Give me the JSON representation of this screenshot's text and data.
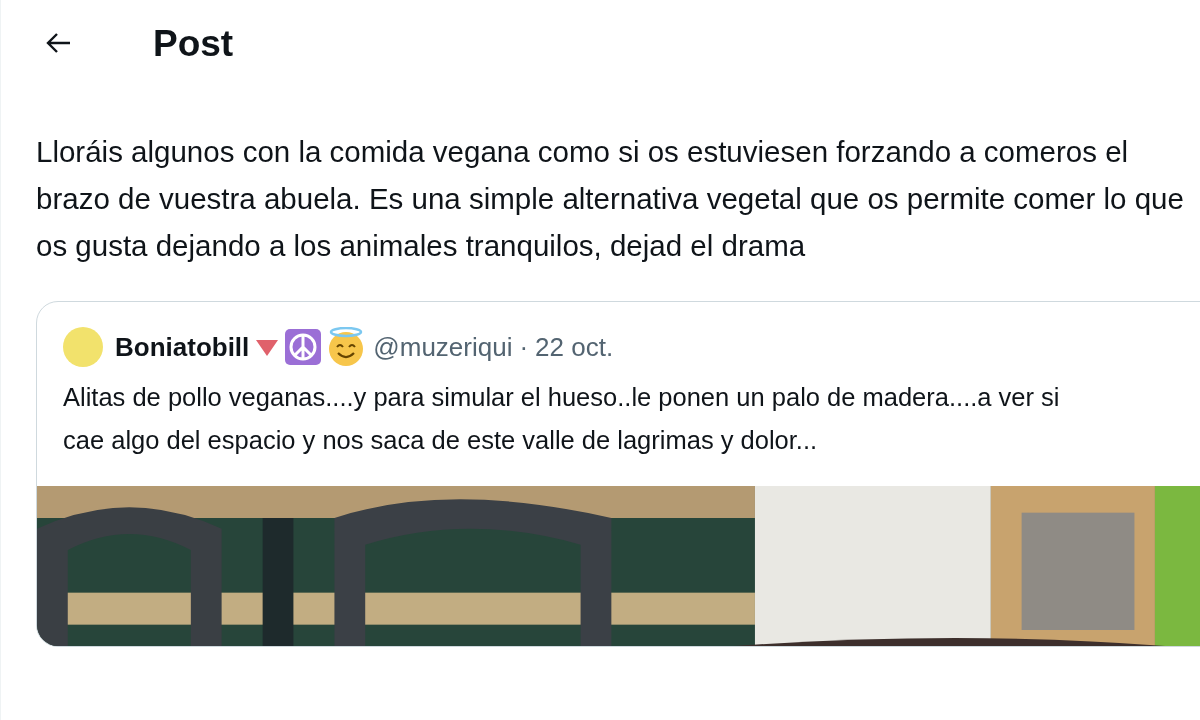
{
  "header": {
    "title": "Post"
  },
  "post": {
    "text": "Lloráis algunos con la comida vegana como si os estuviesen forzando a comeros el brazo de vuestra abuela. Es una simple alternativa vegetal que os permite comer lo que os gusta dejando a los animales tranquilos, dejad el drama"
  },
  "quoted_post": {
    "display_name": "Boniatobill",
    "handle": "@muzeriqui",
    "separator": "·",
    "date": "22 oct.",
    "text": "Alitas de pollo veganas....y para simular el hueso..le ponen un palo de madera....a ver si cae algo del espacio y nos saca de este valle de lagrimas y dolor..."
  }
}
